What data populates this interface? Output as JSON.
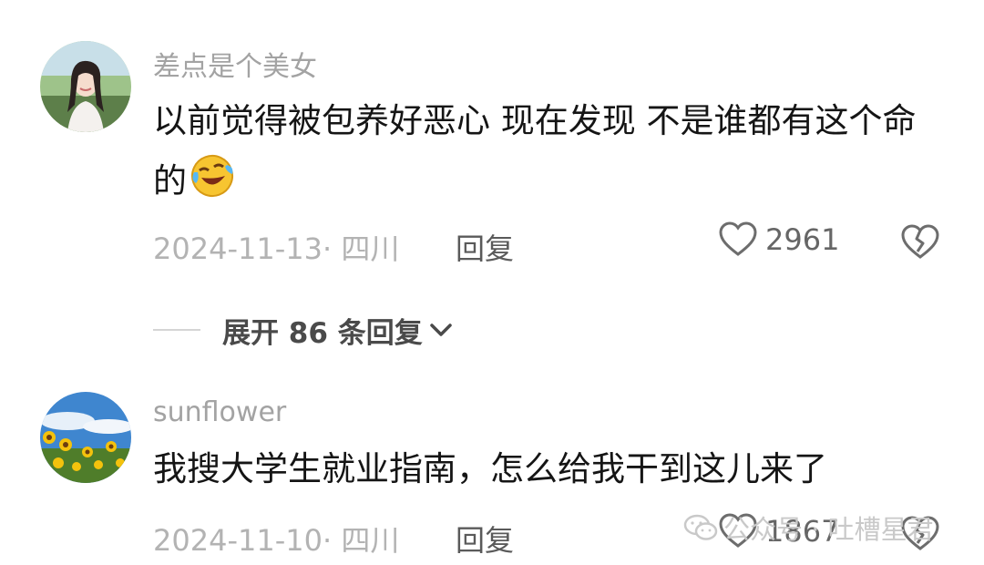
{
  "comments": [
    {
      "username": "差点是个美女",
      "text": "以前觉得被包养好恶心 现在发现 不是谁都有这个命的",
      "emoji": "laughing-crying-emoji",
      "date": "2024-11-13· 四川",
      "reply_label": "回复",
      "likes": "2961",
      "avatar": "girl-photo-avatar"
    },
    {
      "username": "sunflower",
      "text": "我搜大学生就业指南，怎么给我干到这儿来了",
      "date": "2024-11-10· 四川",
      "reply_label": "回复",
      "likes": "1867",
      "avatar": "sunflower-field-avatar"
    }
  ],
  "expand_replies": {
    "label": "展开 86 条回复",
    "icon": "chevron-down-icon"
  },
  "watermark": {
    "text": "公众号 · 吐槽星君",
    "icon": "wechat-icon"
  },
  "colors": {
    "username": "#a3a3a3",
    "text": "#151515",
    "meta": "#b3b3b3",
    "reply": "#5a5a5a"
  }
}
